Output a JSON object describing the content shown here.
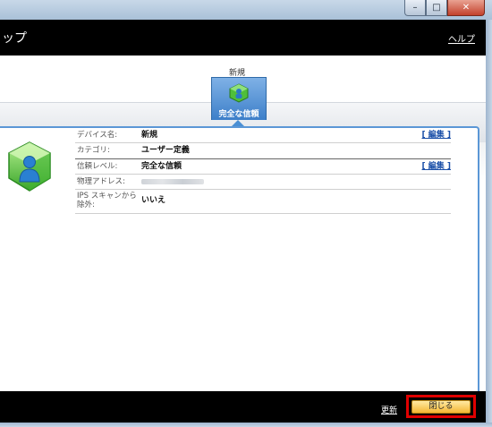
{
  "window": {
    "controls": {
      "minimize": "–",
      "maximize": "□",
      "close": "✕"
    }
  },
  "header": {
    "title": "ップ",
    "help_link": "ヘルプ"
  },
  "device": {
    "name_heading": "新規",
    "trust_level_tab": "完全な信頼",
    "icon": "trusted-device-icon"
  },
  "details": {
    "rows": [
      {
        "label": "デバイス名:",
        "value": "新規",
        "edit": "[ 編集 ]"
      },
      {
        "label": "カテゴリ:",
        "value": "ユーザー定義"
      },
      {
        "label": "信頼レベル:",
        "value": "完全な信頼",
        "edit": "[ 編集 ]"
      },
      {
        "label": "物理アドレス:"
      },
      {
        "label": "IPS スキャンから除外:",
        "value": "いいえ"
      }
    ]
  },
  "footer": {
    "update_link": "更新",
    "close_button": "閉じる"
  },
  "colors": {
    "header_bg": "#000000",
    "accent_blue": "#5b97d6",
    "close_button": "#f4b733",
    "highlight": "#e00000"
  }
}
